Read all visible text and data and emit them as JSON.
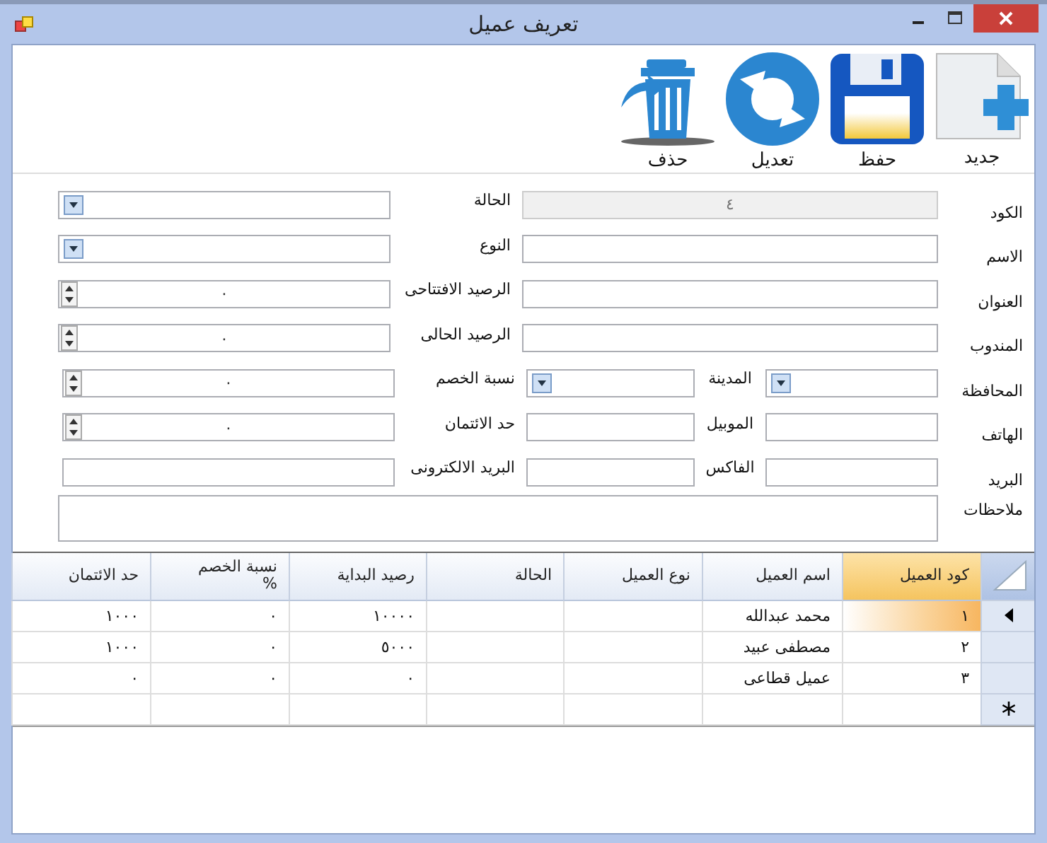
{
  "window": {
    "title": "تعريف عميل"
  },
  "toolbar": [
    {
      "label": "جديد",
      "kind": "new"
    },
    {
      "label": "حفظ",
      "kind": "save"
    },
    {
      "label": "تعديل",
      "kind": "refresh"
    },
    {
      "label": "حذف",
      "kind": "delete"
    }
  ],
  "form": {
    "rows": [
      {
        "fields": [
          {
            "label": "الكود",
            "kind": "text",
            "value": "٤",
            "disabled": true
          },
          {
            "label": "الحالة",
            "kind": "combo",
            "disabled": false
          }
        ]
      },
      {
        "fields": [
          {
            "label": "الاسم",
            "kind": "text",
            "disabled": false
          },
          {
            "label": "النوع",
            "kind": "combo",
            "disabled": false
          }
        ]
      },
      {
        "fields": [
          {
            "label": "العنوان",
            "kind": "text",
            "disabled": false
          },
          {
            "label": "الرصيد الافتتاحى",
            "kind": "spin",
            "value": "٠",
            "disabled": false
          }
        ]
      },
      {
        "fields": [
          {
            "label": "المندوب",
            "kind": "text",
            "disabled": false
          },
          {
            "label": "الرصيد الحالى",
            "kind": "spin",
            "value": "٠",
            "disabled": false
          }
        ]
      },
      {
        "fields": [
          {
            "label": "المحافظة",
            "kind": "combo",
            "disabled": false
          },
          {
            "label": "المدينة",
            "kind": "combo",
            "disabled": false
          },
          {
            "label": "نسبة الخصم",
            "kind": "spin",
            "value": "٠",
            "disabled": false
          }
        ]
      },
      {
        "fields": [
          {
            "label": "الهاتف",
            "kind": "text",
            "disabled": false
          },
          {
            "label": "الموبيل",
            "kind": "text",
            "disabled": false
          },
          {
            "label": "حد الائتمان",
            "kind": "spin",
            "value": "٠",
            "disabled": false
          }
        ]
      },
      {
        "fields": [
          {
            "label": "البريد",
            "kind": "text",
            "disabled": false
          },
          {
            "label": "الفاكس",
            "kind": "text",
            "disabled": false
          },
          {
            "label": "البريد الالكترونى",
            "kind": "text",
            "disabled": false
          }
        ]
      },
      {
        "fields": [
          {
            "label": "ملاحظات",
            "kind": "textarea",
            "disabled": false
          }
        ]
      }
    ]
  },
  "table": {
    "columns": [
      {
        "label": "كود العميل",
        "selected": true
      },
      {
        "label": "اسم العميل",
        "selected": false
      },
      {
        "label": "نوع العميل",
        "selected": false
      },
      {
        "label": "الحالة",
        "selected": false
      },
      {
        "label": "رصيد البداية",
        "selected": false
      },
      {
        "label": "نسبة الخصم\n%",
        "selected": false
      },
      {
        "label": "حد الائتمان",
        "selected": false
      }
    ],
    "rows": [
      {
        "kind": "data",
        "selected": true,
        "cells": [
          "١",
          "محمد عبدالله",
          "",
          "",
          "١٠٠٠٠",
          "٠",
          "١٠٠٠"
        ]
      },
      {
        "kind": "data",
        "selected": false,
        "cells": [
          "٢",
          "مصطفى عبيد",
          "",
          "",
          "٥٠٠٠",
          "٠",
          "١٠٠٠"
        ]
      },
      {
        "kind": "data",
        "selected": false,
        "cells": [
          "٣",
          "عميل قطاعى",
          "",
          "",
          "٠",
          "٠",
          "٠"
        ]
      },
      {
        "kind": "new",
        "selected": false,
        "cells": [
          "",
          "",
          "",
          "",
          "",
          "",
          ""
        ]
      }
    ]
  }
}
